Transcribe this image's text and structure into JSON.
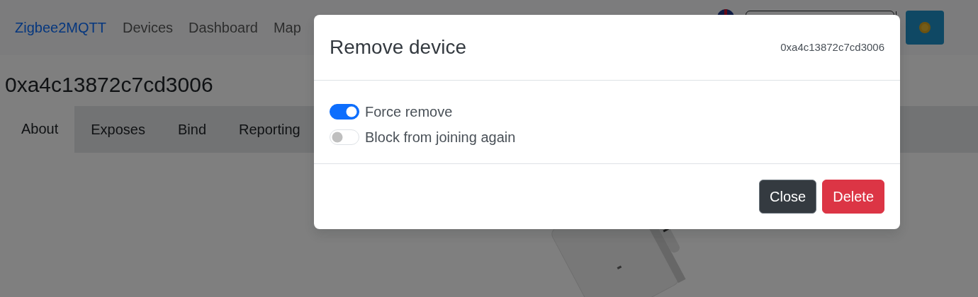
{
  "navbar": {
    "brand": "Zigbee2MQTT",
    "links": [
      "Devices",
      "Dashboard",
      "Map"
    ]
  },
  "device": {
    "title": "0xa4c13872c7cd3006",
    "tabs": [
      {
        "label": "About",
        "selected": true
      },
      {
        "label": "Exposes",
        "selected": false
      },
      {
        "label": "Bind",
        "selected": false
      },
      {
        "label": "Reporting",
        "selected": false
      }
    ]
  },
  "modal": {
    "title": "Remove device",
    "subtitle": "0xa4c13872c7cd3006",
    "options": [
      {
        "label": "Force remove",
        "checked": true
      },
      {
        "label": "Block from joining again",
        "checked": false
      }
    ],
    "buttons": [
      {
        "label": "Close",
        "kind": "secondary"
      },
      {
        "label": "Delete",
        "kind": "danger"
      }
    ]
  }
}
